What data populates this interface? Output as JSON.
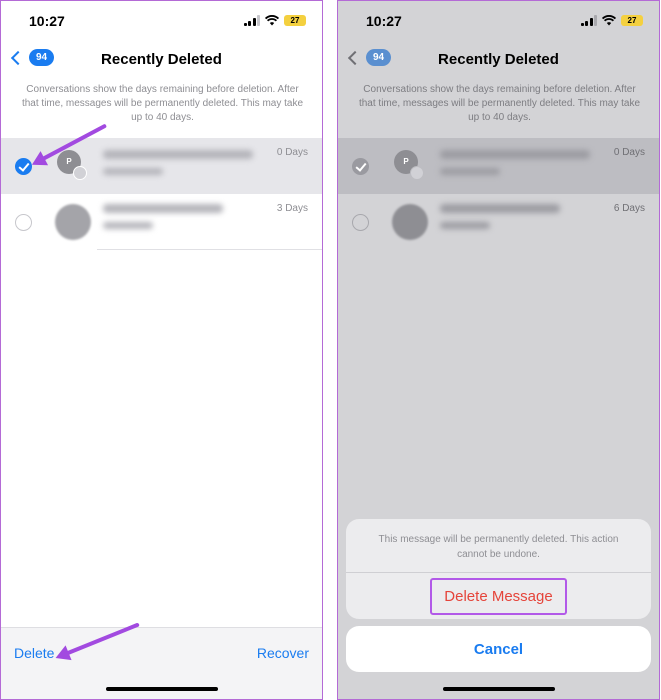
{
  "status": {
    "time": "10:27",
    "battery": "27"
  },
  "nav": {
    "back_count": "94",
    "title": "Recently Deleted"
  },
  "description": "Conversations show the days remaining before deletion. After that time, messages will be permanently deleted. This may take up to 40 days.",
  "left": {
    "rows": [
      {
        "avatar_letter": "P",
        "days": "0 Days",
        "selected": true
      },
      {
        "days": "3 Days",
        "selected": false
      }
    ],
    "toolbar": {
      "delete": "Delete",
      "recover": "Recover"
    }
  },
  "right": {
    "rows": [
      {
        "avatar_letter": "P",
        "days": "0 Days"
      },
      {
        "days": "6 Days"
      }
    ],
    "sheet": {
      "message": "This message will be permanently deleted. This action cannot be undone.",
      "delete_label": "Delete Message",
      "cancel_label": "Cancel"
    }
  },
  "colors": {
    "accent": "#1a7cf0",
    "destructive": "#e5443a",
    "annotation": "#a24ae0"
  }
}
